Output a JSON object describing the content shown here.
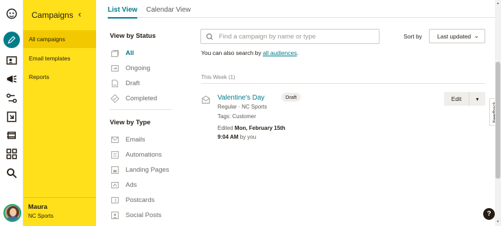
{
  "icons": {
    "rail": [
      "freddie-logo-icon",
      "pencil-create-icon",
      "audience-icon",
      "campaigns-megaphone-icon",
      "automations-icon",
      "landing-pages-icon",
      "content-studio-icon",
      "integrations-grid-icon",
      "search-icon"
    ]
  },
  "nav": {
    "title": "Campaigns",
    "collapse_glyph": "‹",
    "items": [
      {
        "label": "All campaigns",
        "active": true
      },
      {
        "label": "Email templates",
        "active": false
      },
      {
        "label": "Reports",
        "active": false
      }
    ],
    "user": {
      "name": "Maura",
      "org": "NC Sports"
    }
  },
  "tabs": [
    {
      "label": "List View",
      "active": true
    },
    {
      "label": "Calendar View",
      "active": false
    }
  ],
  "filters": {
    "status_heading": "View by Status",
    "status": [
      {
        "label": "All",
        "icon": "all-icon",
        "active": true
      },
      {
        "label": "Ongoing",
        "icon": "ongoing-icon",
        "active": false
      },
      {
        "label": "Draft",
        "icon": "draft-icon",
        "active": false
      },
      {
        "label": "Completed",
        "icon": "completed-icon",
        "active": false
      }
    ],
    "type_heading": "View by Type",
    "types": [
      {
        "label": "Emails",
        "icon": "email-icon"
      },
      {
        "label": "Automations",
        "icon": "automation-icon"
      },
      {
        "label": "Landing Pages",
        "icon": "landing-page-icon"
      },
      {
        "label": "Ads",
        "icon": "ads-icon"
      },
      {
        "label": "Postcards",
        "icon": "postcard-icon"
      },
      {
        "label": "Social Posts",
        "icon": "social-post-icon"
      }
    ]
  },
  "search": {
    "placeholder": "Find a campaign by name or type",
    "hint_prefix": "You can also search by ",
    "hint_link": "all audiences",
    "hint_suffix": "."
  },
  "sort": {
    "label": "Sort by",
    "value": "Last updated"
  },
  "list": {
    "section_label": "This Week (1)",
    "campaigns": [
      {
        "name": "Valentine's Day",
        "status": "Draft",
        "meta": "Regular · NC Sports",
        "tags": "Tags: Customer",
        "edited_prefix": "Edited ",
        "edited_date": "Mon, February 15th 9:04 AM",
        "edited_suffix": " by you",
        "action": "Edit"
      }
    ]
  },
  "feedback_label": "Feedback",
  "help_label": "?",
  "colors": {
    "brand_yellow": "#ffe01b",
    "accent_teal": "#007c89",
    "text_dark": "#241c15"
  }
}
